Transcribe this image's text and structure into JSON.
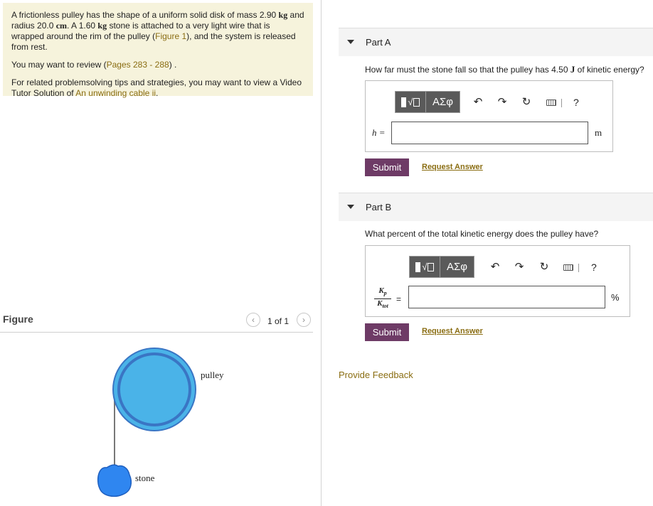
{
  "problem": {
    "text1a": "A frictionless pulley has the shape of a uniform solid disk of mass 2.90 ",
    "unit_kg": "kg",
    "text1b": " and radius 20.0 ",
    "unit_cm": "cm",
    "text1c": ". A 1.60 ",
    "unit_kg2": "kg",
    "text1d": " stone is attached to a very light wire that is wrapped around the rim of the pulley (",
    "figure_link": "Figure 1",
    "text1e": "), and the system is released from rest.",
    "review_text": "You may want to review (",
    "review_link": "Pages 283 - 288",
    "review_end": ") .",
    "related_text": "For related problemsolving tips and strategies, you may want to view a Video Tutor Solution of ",
    "tutor_link": "An unwinding cable ii",
    "tutor_end": "."
  },
  "figure": {
    "title": "Figure",
    "counter": "1 of 1",
    "prev_icon": "chevron-left-icon",
    "next_icon": "chevron-right-icon",
    "pulley_label": "pulley",
    "stone_label": "stone",
    "colors": {
      "disk": "#4ab3e8",
      "disk_ring": "#3a75c4",
      "stone": "#2f86f0",
      "wire": "#777777"
    }
  },
  "partA": {
    "title": "Part A",
    "question_pre": "How far must the stone fall so that the pulley has 4.50 ",
    "question_unit": "J",
    "question_post": " of kinetic energy?",
    "var_label": "h =",
    "unit": "m",
    "symbols_label": "ΑΣφ",
    "help": "?",
    "submit": "Submit",
    "request": "Request Answer"
  },
  "partB": {
    "title": "Part B",
    "question": "What percent of the total kinetic energy does the pulley have?",
    "frac_num": "K",
    "frac_num_sub": "p",
    "frac_den": "K",
    "frac_den_sub": "tot",
    "equals": "=",
    "unit": "%",
    "symbols_label": "ΑΣφ",
    "help": "?",
    "submit": "Submit",
    "request": "Request Answer"
  },
  "feedback": "Provide Feedback",
  "colors": {
    "accent": "#6e3b66",
    "link": "#8a6d12",
    "problem_bg": "#f6f3dc",
    "part_bg": "#f4f4f4"
  }
}
